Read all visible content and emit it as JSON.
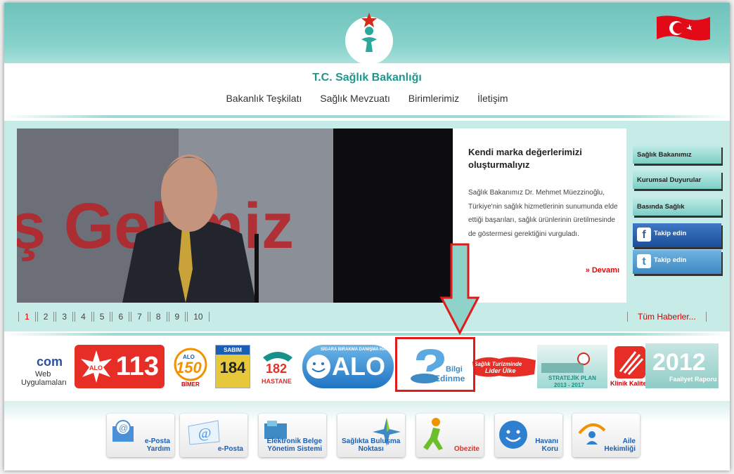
{
  "header": {
    "site_title": "T.C. Sağlık Bakanlığı"
  },
  "nav": [
    "Bakanlık Teşkilatı",
    "Sağlık Mevzuatı",
    "Birimlerimiz",
    "İletişim"
  ],
  "slide": {
    "bg_text": "ş Gel   miz"
  },
  "news": {
    "title": "Kendi marka değerlerimizi oluşturmalıyız",
    "body": "Sağlık Bakanımız Dr. Mehmet Müezzinoğlu, Türkiye'nin sağlık hizmetlerinin sunumunda elde ettiği başarıları, sağlık ürünlerinin üretilmesinde de göstermesi gerektiğini vurguladı.",
    "more": "» Devamı"
  },
  "side_buttons": [
    "Sağlık Bakanımız",
    "Kurumsal Duyurular",
    "Basında Sağlık",
    "Takip edin",
    "Takip edin"
  ],
  "pager": {
    "pages": [
      "1",
      "2",
      "3",
      "4",
      "5",
      "6",
      "7",
      "8",
      "9",
      "10"
    ],
    "active": "1",
    "all_news": "Tüm Haberler..."
  },
  "banners": {
    "web": {
      "logo": "com",
      "label1": "Web",
      "label2": "Uygulamaları"
    },
    "alo113": {
      "small": "ALO",
      "number": "113"
    },
    "alo150": {
      "small": "ALO",
      "number": "150",
      "label": "BİMER"
    },
    "sabim": {
      "top": "SABIM",
      "number": "184"
    },
    "hastane": {
      "number": "182",
      "label": "HASTANE"
    },
    "alo171": {
      "top": "SİGARA BIRAKMA DANIŞMA HATTI",
      "number": "ALO 171"
    },
    "bilgi": {
      "line1": "Bilgi",
      "line2": "Edinme"
    },
    "turizm": {
      "line1": "Sağlık Turizminde",
      "line2": "Lider Ülke"
    },
    "stratejik": {
      "label": "STRATEJİK PLAN",
      "years": "2013 - 2017"
    },
    "klinik": {
      "label": "Klinik Kalite"
    },
    "faaliyet": {
      "year": "2012",
      "label": "Faaliyet Raporu"
    }
  },
  "apps": [
    {
      "name": "eposta-yardim",
      "l1": "e-Posta",
      "l2": "Yardım"
    },
    {
      "name": "eposta",
      "l1": "e-Posta",
      "l2": ""
    },
    {
      "name": "ebys",
      "l1": "Elektronik Belge",
      "l2": "Yönetim Sistemi"
    },
    {
      "name": "saglikta-bulusma",
      "l1": "Sağlıkta Buluşma",
      "l2": "Noktası"
    },
    {
      "name": "obezite",
      "l1": "Obezite",
      "l2": ""
    },
    {
      "name": "havani-koru",
      "l1": "Havanı",
      "l2": "Koru"
    },
    {
      "name": "aile-hekimligi",
      "l1": "Aile",
      "l2": "Hekimliği"
    }
  ],
  "colors": {
    "teal": "#7ccfc6",
    "red": "#e11b1b",
    "link_red": "#d00000",
    "title_teal": "#21968c"
  }
}
